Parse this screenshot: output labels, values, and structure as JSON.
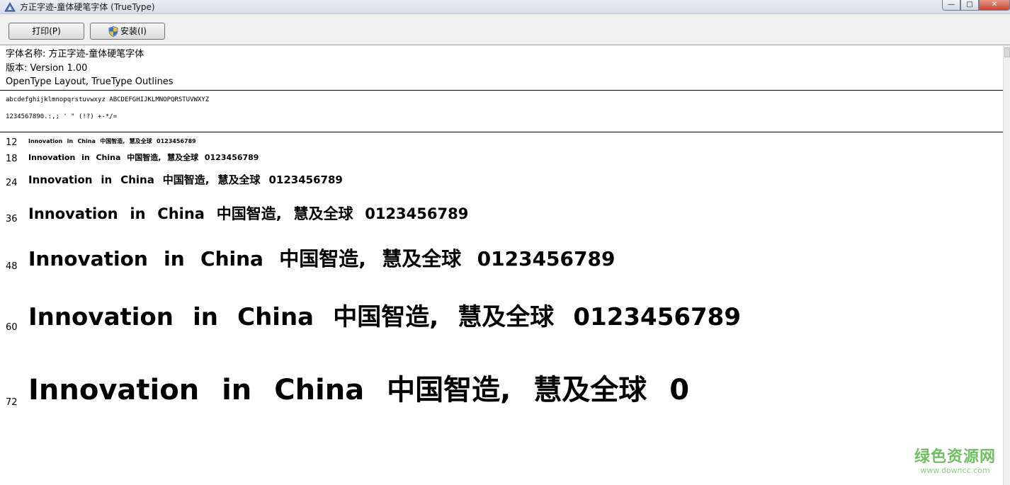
{
  "window": {
    "title": "方正字迹-童体硬笔字体 (TrueType)",
    "minimize_glyph": "—",
    "maximize_glyph": "□",
    "close_glyph": "✕"
  },
  "toolbar": {
    "print_label": "打印(P)",
    "install_label": "安装(I)"
  },
  "font_info": {
    "name_line": "字体名称: 方正字迹-童体硬笔字体",
    "version_line": "版本: Version 1.00",
    "outline_line": "OpenType Layout, TrueType Outlines"
  },
  "charset": {
    "line1": "abcdefghijklmnopqrstuvwxyz  ABCDEFGHIJKLMNOPQRSTUVWXYZ",
    "line2": "1234567890.:,;  ' \"  (!?)  +-*/="
  },
  "samples": [
    {
      "size": "12",
      "text": "Innovation in China 中国智造, 慧及全球 0123456789"
    },
    {
      "size": "18",
      "text": "Innovation in China 中国智造, 慧及全球 0123456789"
    },
    {
      "size": "24",
      "text": "Innovation in China 中国智造, 慧及全球 0123456789"
    },
    {
      "size": "36",
      "text": "Innovation in China 中国智造, 慧及全球 0123456789"
    },
    {
      "size": "48",
      "text": "Innovation in China 中国智造, 慧及全球 0123456789"
    },
    {
      "size": "60",
      "text": "Innovation in China 中国智造, 慧及全球 0123456789"
    },
    {
      "size": "72",
      "text": "Innovation in China 中国智造, 慧及全球 0"
    }
  ],
  "watermark": {
    "name": "绿色资源网",
    "url": "www.downcc.com"
  },
  "icons": {
    "app": "font-app-icon",
    "install": "uac-shield-icon"
  },
  "colors": {
    "watermark_green": "#6fbf63",
    "titlebar": "#dfe6ee",
    "toolbar": "#f0f0f0"
  }
}
